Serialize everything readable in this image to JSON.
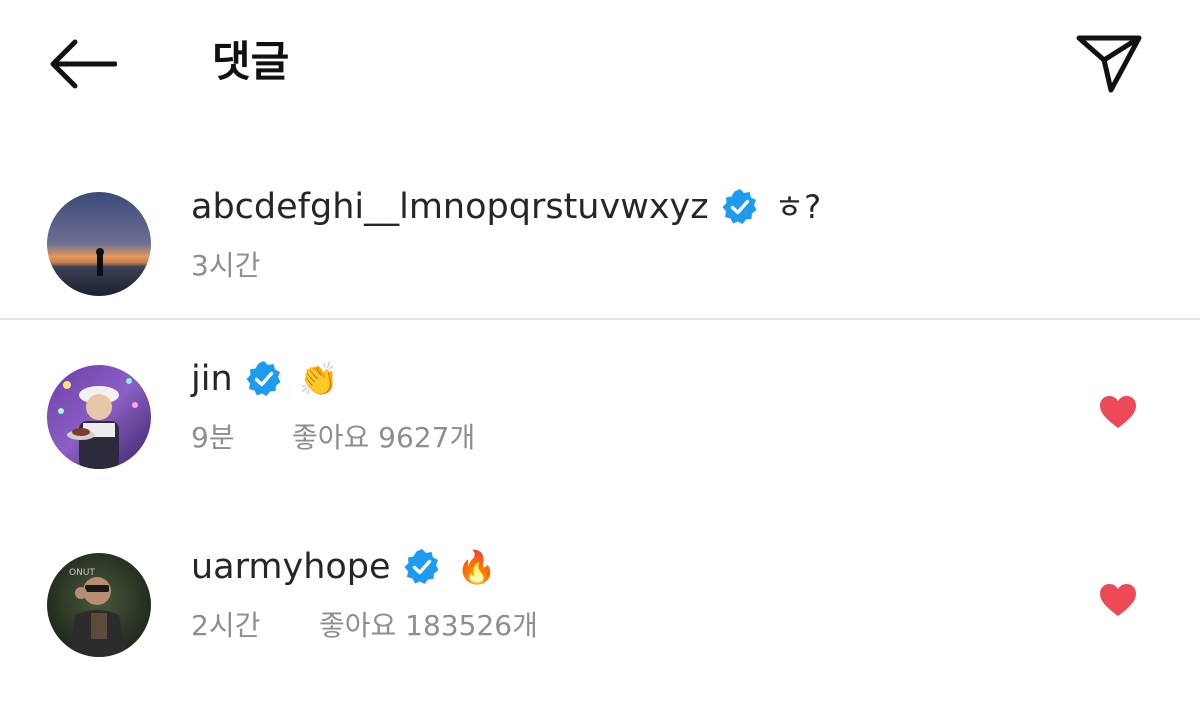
{
  "header": {
    "title": "댓글",
    "icons": {
      "back": "back-arrow-icon",
      "share": "paper-plane-icon"
    }
  },
  "caption": {
    "username": "abcdefghi__lmnopqrstuvwxyz",
    "text": "ㅎ?",
    "time": "3시간"
  },
  "comments": [
    {
      "username": "jin",
      "text": "👏",
      "time": "9분",
      "likes": "좋아요 9627개",
      "liked": true
    },
    {
      "username": "uarmyhope",
      "text": "🔥",
      "time": "2시간",
      "likes": "좋아요 183526개",
      "liked": true
    }
  ],
  "colors": {
    "verified": "#1d9bf0",
    "heart": "#ed4956",
    "meta": "#8e8e8e",
    "text": "#262626"
  }
}
